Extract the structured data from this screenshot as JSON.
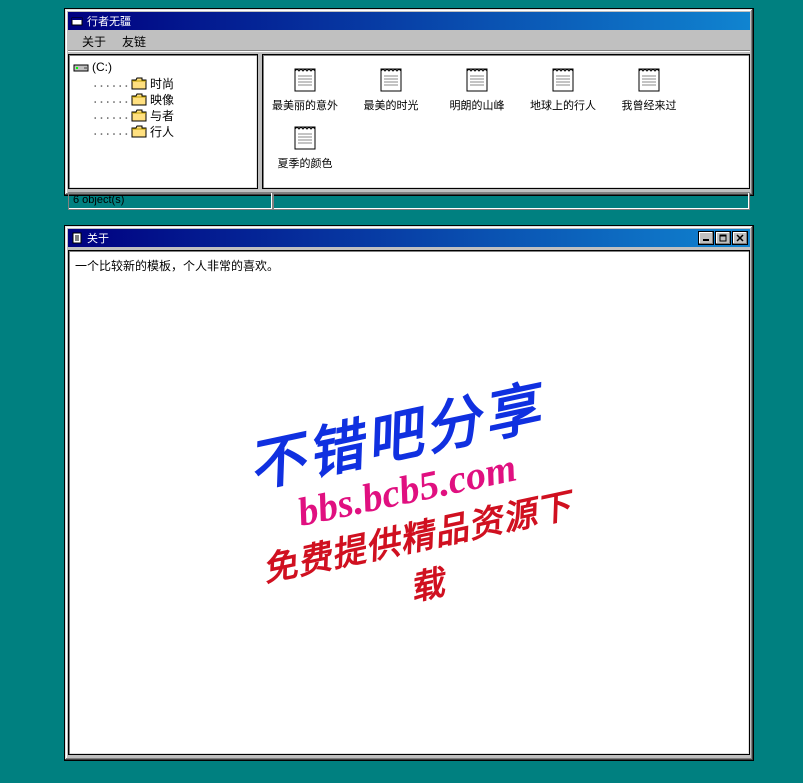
{
  "window1": {
    "title": "行者无疆",
    "menu": [
      "关于",
      "友链"
    ],
    "tree": {
      "root": "(C:)",
      "folders": [
        "时尚",
        "映像",
        "与者",
        "行人"
      ]
    },
    "files": [
      "最美丽的意外",
      "最美的时光",
      "明朗的山峰",
      "地球上的行人",
      "我曾经来过",
      "夏季的颜色"
    ],
    "status": "6 object(s)"
  },
  "window2": {
    "title": "关于",
    "body_text": "一个比较新的模板，个人非常的喜欢。",
    "watermark": {
      "line1": "不错吧分享",
      "line2": "bbs.bcb5.com",
      "line3": "免费提供精品资源下载"
    }
  }
}
